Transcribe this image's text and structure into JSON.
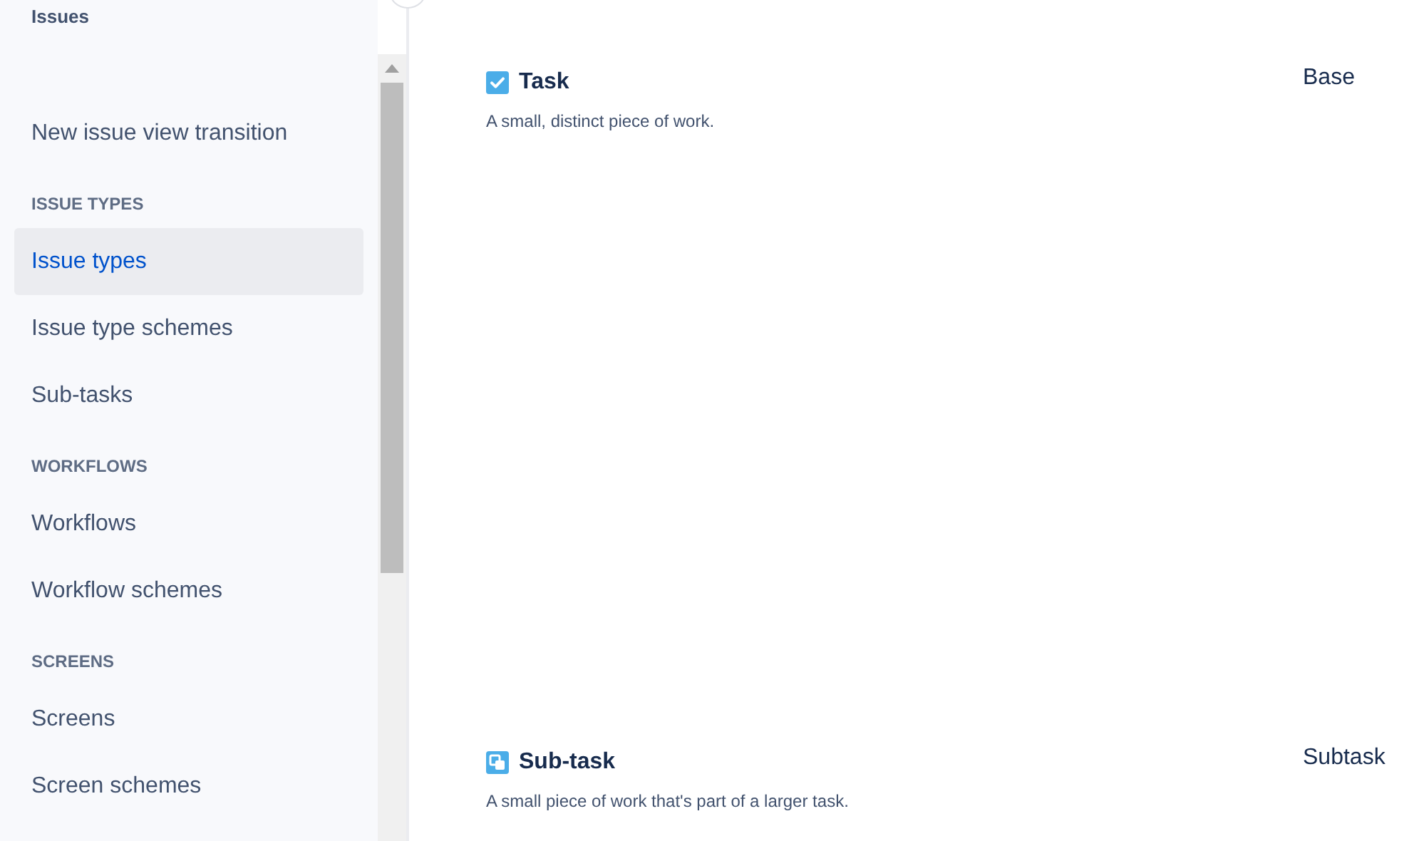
{
  "sidebar": {
    "title": "Issues",
    "sections": [
      {
        "items": [
          {
            "label": "New issue view transition",
            "selected": false
          }
        ]
      },
      {
        "heading": "ISSUE TYPES",
        "items": [
          {
            "label": "Issue types",
            "selected": true
          },
          {
            "label": "Issue type schemes",
            "selected": false
          },
          {
            "label": "Sub-tasks",
            "selected": false
          }
        ]
      },
      {
        "heading": "WORKFLOWS",
        "items": [
          {
            "label": "Workflows",
            "selected": false
          },
          {
            "label": "Workflow schemes",
            "selected": false
          }
        ]
      },
      {
        "heading": "SCREENS",
        "items": [
          {
            "label": "Screens",
            "selected": false
          },
          {
            "label": "Screen schemes",
            "selected": false
          }
        ]
      }
    ]
  },
  "issue_types": [
    {
      "kind": "task",
      "name": "Task",
      "description": "A small, distinct piece of work.",
      "type": "Base"
    },
    {
      "kind": "subtask",
      "name": "Sub-task",
      "description": "A small piece of work that's part of a larger task.",
      "type": "Subtask"
    }
  ]
}
